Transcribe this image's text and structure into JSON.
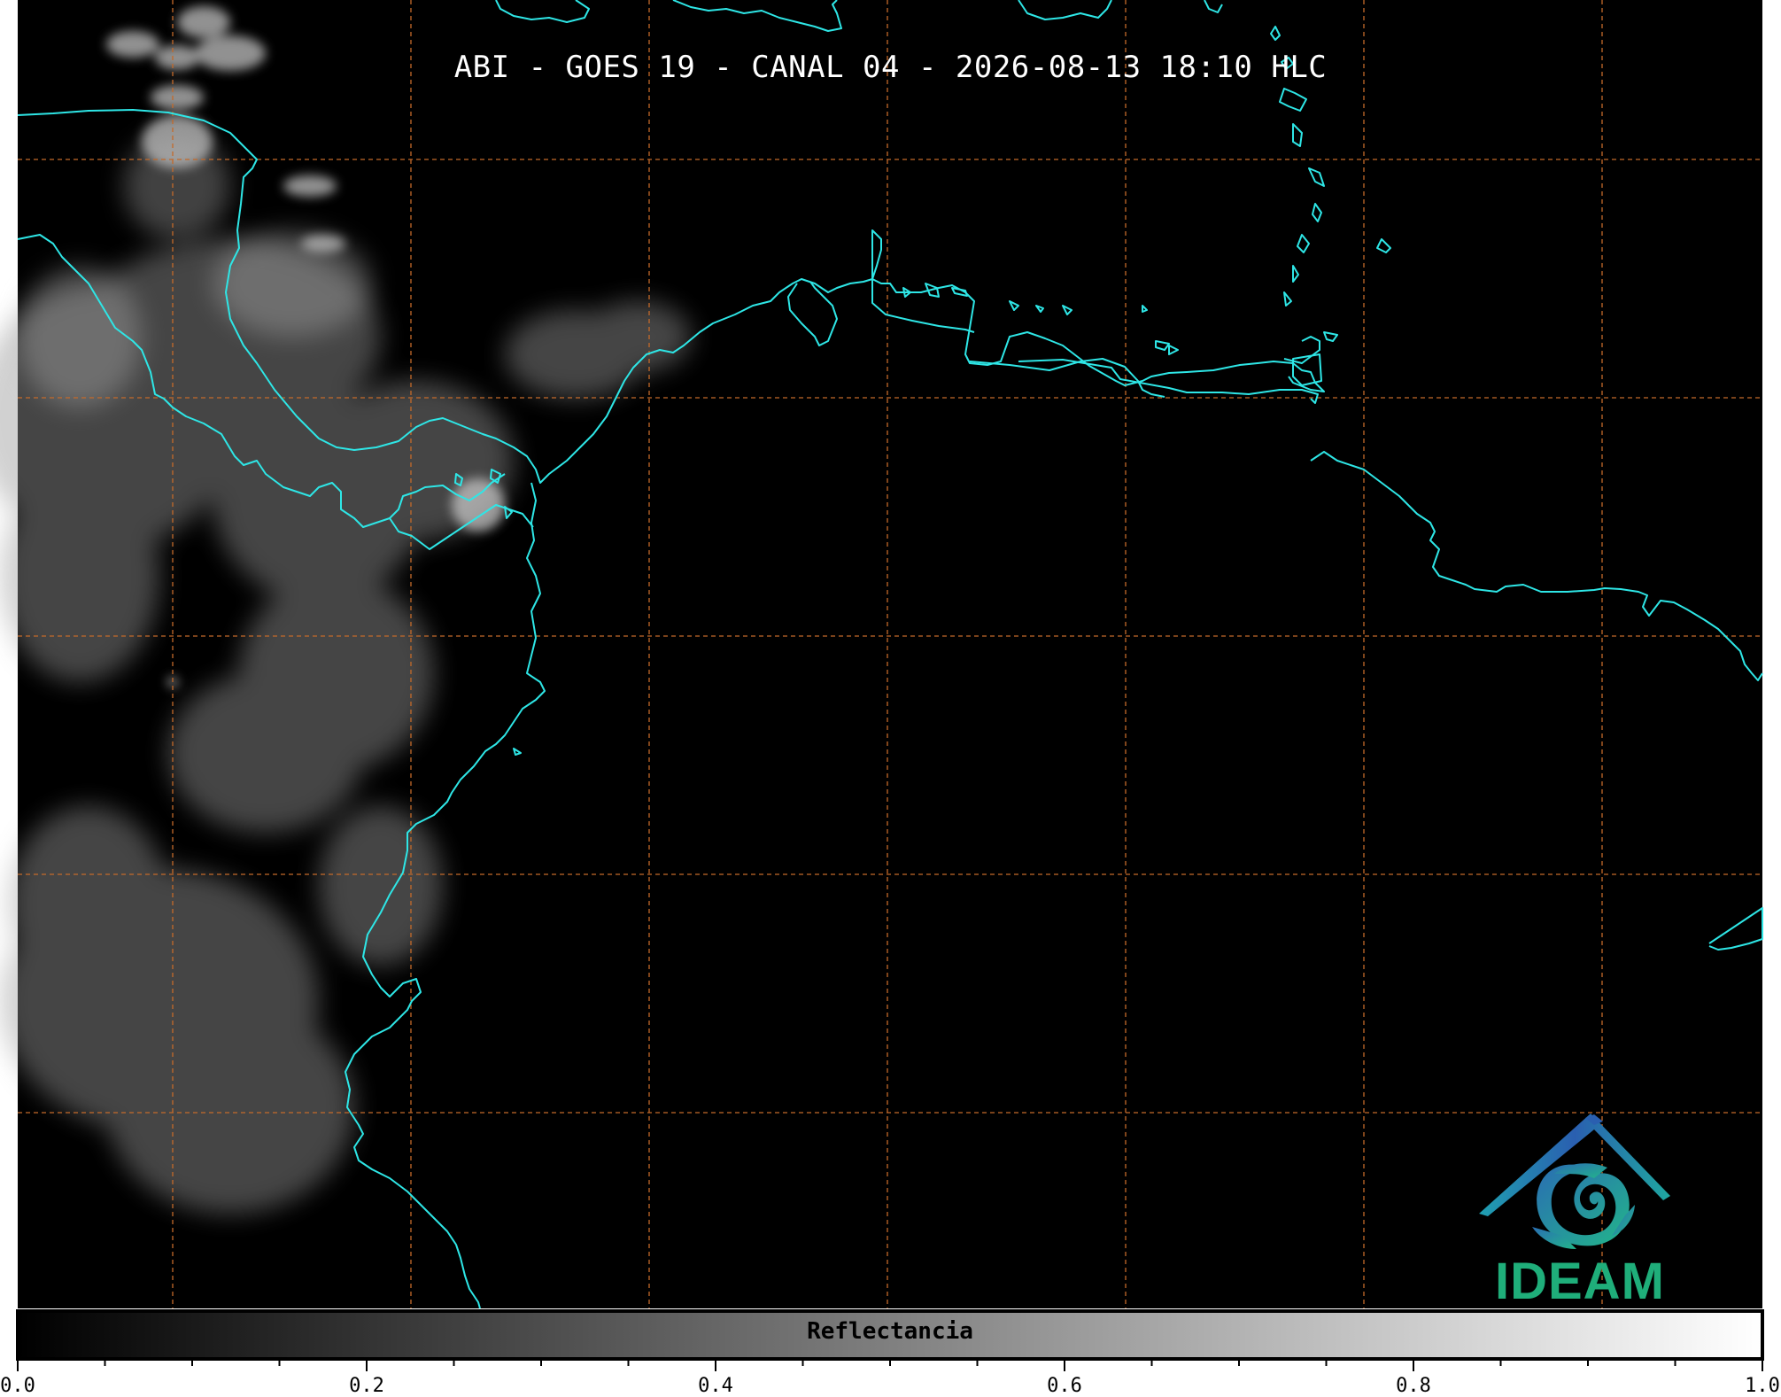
{
  "map": {
    "title": "ABI - GOES 19 - CANAL 04 - 2026-08-13 18:10 HLC",
    "coastline_color": "#2ee6e6",
    "grid_color": "#c46a2a",
    "background_color": "#000000",
    "grid_style": "dashed"
  },
  "logo": {
    "text": "IDEAM",
    "text_color": "#1fae7a",
    "icon": "ideam-swirl-logo-icon",
    "colors": [
      "#2a6db3",
      "#1fa7a0",
      "#22b58a"
    ]
  },
  "colorbar": {
    "label": "Reflectancia",
    "range": [
      0.0,
      1.0
    ],
    "colormap": "grayscale black-to-white",
    "tick_labels": [
      "0.0",
      "0.2",
      "0.4",
      "0.6",
      "0.8",
      "1.0"
    ]
  }
}
